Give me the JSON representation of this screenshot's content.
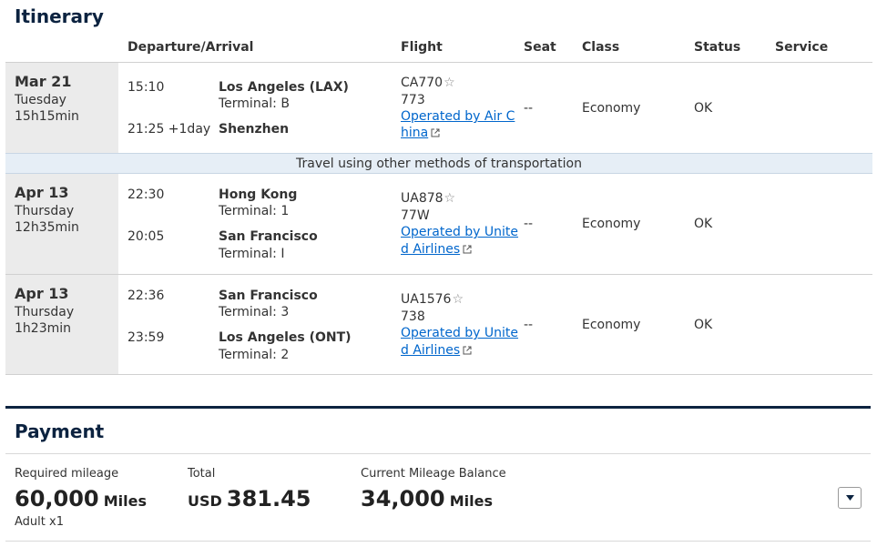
{
  "itinerary": {
    "title": "Itinerary",
    "columns": {
      "departure_arrival": "Departure/Arrival",
      "flight": "Flight",
      "seat": "Seat",
      "class": "Class",
      "status": "Status",
      "service": "Service"
    },
    "segments": [
      {
        "date": "Mar 21",
        "weekday": "Tuesday",
        "duration": "15h15min",
        "dep_time": "15:10",
        "dep_airport": "Los Angeles (LAX)",
        "dep_terminal": "Terminal: B",
        "arr_time": "21:25 +1day",
        "arr_airport": "Shenzhen",
        "arr_terminal": "",
        "flight_no": "CA770",
        "aircraft": "773",
        "operated_line1": "Operated by Air C",
        "operated_line2": "hina",
        "seat": "--",
        "class": "Economy",
        "status": "OK"
      },
      {
        "date": "Apr 13",
        "weekday": "Thursday",
        "duration": "12h35min",
        "dep_time": "22:30",
        "dep_airport": "Hong Kong",
        "dep_terminal": "Terminal: 1",
        "arr_time": "20:05",
        "arr_airport": "San Francisco",
        "arr_terminal": "Terminal: I",
        "flight_no": "UA878",
        "aircraft": "77W",
        "operated_line1": "Operated by Unite",
        "operated_line2": "d Airlines",
        "seat": "--",
        "class": "Economy",
        "status": "OK"
      },
      {
        "date": "Apr 13",
        "weekday": "Thursday",
        "duration": "1h23min",
        "dep_time": "22:36",
        "dep_airport": "San Francisco",
        "dep_terminal": "Terminal: 3",
        "arr_time": "23:59",
        "arr_airport": "Los Angeles (ONT)",
        "arr_terminal": "Terminal: 2",
        "flight_no": "UA1576",
        "aircraft": "738",
        "operated_line1": "Operated by Unite",
        "operated_line2": "d Airlines",
        "seat": "--",
        "class": "Economy",
        "status": "OK"
      }
    ],
    "transfer_note": "Travel using other methods of transportation"
  },
  "payment": {
    "title": "Payment",
    "required_label": "Required mileage",
    "required_value": "60,000",
    "required_unit": "Miles",
    "passenger": "Adult x1",
    "total_label": "Total",
    "total_currency": "USD",
    "total_value": "381.45",
    "balance_label": "Current Mileage Balance",
    "balance_value": "34,000",
    "balance_unit": "Miles"
  },
  "icons": {
    "favorite": "star-outline-icon",
    "external_link": "external-link-icon",
    "expand": "chevron-down-icon"
  },
  "colors": {
    "heading": "#0c2340",
    "link": "#0066cc",
    "date_column_bg": "#ebebeb",
    "transfer_bg": "#e6eef6"
  }
}
